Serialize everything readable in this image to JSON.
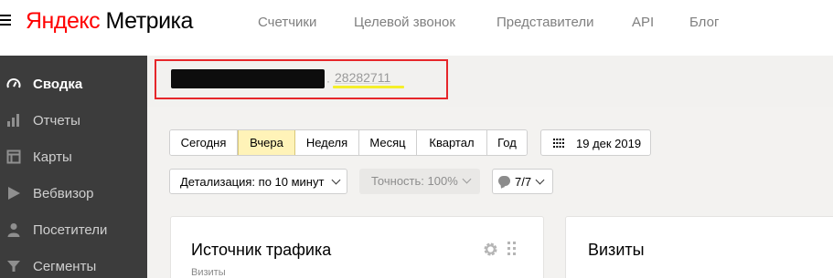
{
  "header": {
    "logo_brand": "Яндекс",
    "logo_product": "Метрика",
    "nav": [
      "Счетчики",
      "Целевой звонок",
      "Представители",
      "API",
      "Блог"
    ]
  },
  "sidebar": {
    "items": [
      {
        "label": "Сводка",
        "icon": "gauge-icon",
        "active": true
      },
      {
        "label": "Отчеты",
        "icon": "bar-chart-icon",
        "active": false
      },
      {
        "label": "Карты",
        "icon": "map-icon",
        "active": false
      },
      {
        "label": "Вебвизор",
        "icon": "play-icon",
        "active": false
      },
      {
        "label": "Посетители",
        "icon": "user-icon",
        "active": false
      },
      {
        "label": "Сегменты",
        "icon": "filter-icon",
        "active": false
      }
    ]
  },
  "counter": {
    "id": "28282711",
    "separator": "·"
  },
  "period": {
    "buttons": [
      "Сегодня",
      "Вчера",
      "Неделя",
      "Месяц",
      "Квартал",
      "Год"
    ],
    "active": "Вчера",
    "date": "19 дек 2019"
  },
  "filters": {
    "detail": "Детализация: по 10 минут",
    "accuracy": "Точность: 100%",
    "segments": "7/7"
  },
  "cards": {
    "traffic_title": "Источник трафика",
    "traffic_sub": "Визиты",
    "visits_title": "Визиты"
  },
  "colors": {
    "sidebar_bg": "#3c3c3c",
    "active_period": "#fff3b8",
    "highlight_border": "#e6262a",
    "brand_red": "#ff0000"
  }
}
